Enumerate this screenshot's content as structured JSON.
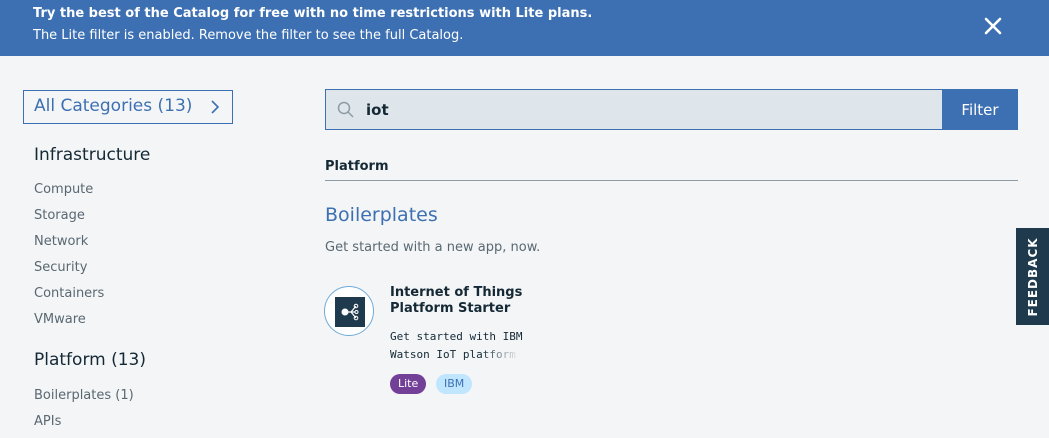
{
  "banner": {
    "line1": "Try the best of the Catalog for free with no time restrictions with Lite plans.",
    "line2": "The Lite filter is enabled. Remove the filter to see the full Catalog.",
    "close_icon": "close-icon"
  },
  "sidebar": {
    "all_categories": "All Categories (13)",
    "infrastructure": {
      "title": "Infrastructure",
      "items": [
        "Compute",
        "Storage",
        "Network",
        "Security",
        "Containers",
        "VMware"
      ]
    },
    "platform": {
      "title": "Platform (13)",
      "items": [
        "Boilerplates (1)",
        "APIs"
      ]
    }
  },
  "search": {
    "value": "iot",
    "filter_label": "Filter",
    "icon": "search-icon"
  },
  "results": {
    "section": "Platform",
    "group": {
      "title": "Boilerplates",
      "description": "Get started with a new app, now."
    },
    "card": {
      "title_line1": "Internet of Things",
      "title_line2": "Platform Starter",
      "desc_line1": "Get started with IBM",
      "desc_line2": "Watson IoT platform",
      "tags": [
        "Lite",
        "IBM"
      ],
      "icon": "iot-platform-icon"
    }
  },
  "feedback": {
    "label": "FEEDBACK"
  },
  "colors": {
    "accent": "#3d70b2",
    "lite_tag": "#734098",
    "ibm_tag": "#c0e6ff",
    "dark": "#1e3a4c"
  }
}
